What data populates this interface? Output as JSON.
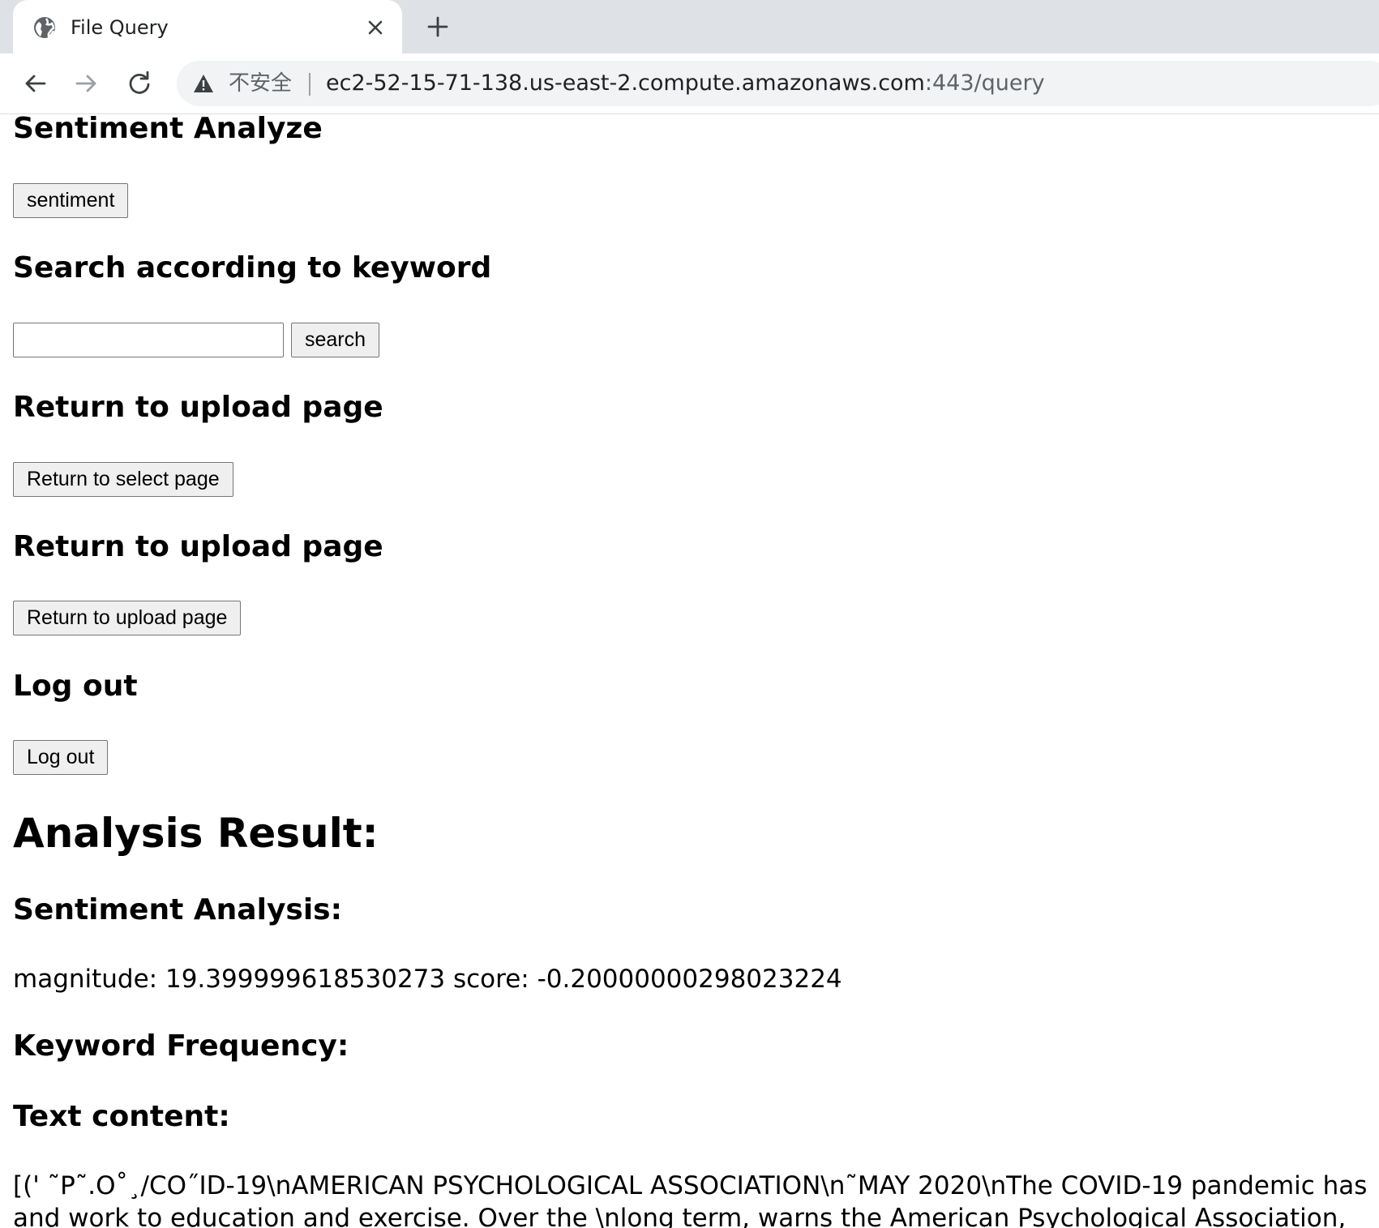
{
  "browser": {
    "tab": {
      "title": "File Query",
      "favicon": "globe-icon",
      "close_icon": "close-icon"
    },
    "new_tab_icon": "plus-icon",
    "nav": {
      "back_icon": "back-arrow-icon",
      "forward_icon": "forward-arrow-icon",
      "reload_icon": "reload-icon"
    },
    "address_bar": {
      "security_icon": "warning-triangle-icon",
      "security_label": "不安全",
      "url_host": "ec2-52-15-71-138.us-east-2.compute.amazonaws.com",
      "url_path": ":443/query"
    }
  },
  "page": {
    "sentiment_section": {
      "heading": "Sentiment Analyze",
      "button_label": "sentiment"
    },
    "search_section": {
      "heading": "Search according to keyword",
      "input_value": "",
      "button_label": "search"
    },
    "return_select_section": {
      "heading": "Return to upload page",
      "button_label": "Return to select page"
    },
    "return_upload_section": {
      "heading": "Return to upload page",
      "button_label": "Return to upload page"
    },
    "logout_section": {
      "heading": "Log out",
      "button_label": "Log out"
    },
    "result": {
      "heading": "Analysis Result:",
      "sentiment_heading": "Sentiment Analysis:",
      "sentiment_text": "magnitude: 19.399999618530273 score: -0.20000000298023224",
      "keyword_heading": "Keyword Frequency:",
      "text_heading": "Text content:",
      "text_body": "[(' ˜P˜.O˚¸/CO˝ID-19\\nAMERICAN PSYCHOLOGICAL ASSOCIATION\\n˜MAY 2020\\nThe COVID-19 pandemic has and work to education and exercise. Over the \\nlong term, warns the American Psychological Association, the"
    }
  },
  "colors": {
    "tabbar_bg": "#dee1e6",
    "omnibox_bg": "#f1f3f4",
    "button_bg": "#efefef",
    "button_border": "#767676"
  }
}
